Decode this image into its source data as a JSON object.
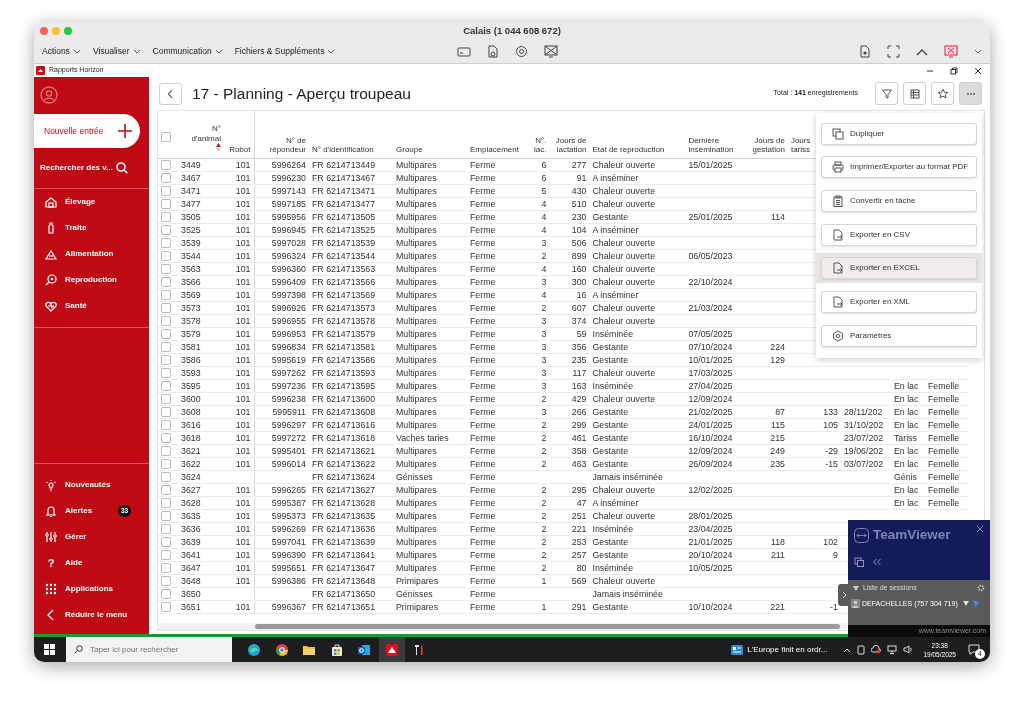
{
  "mac_window": {
    "title": "Calais (1 044 608 672)",
    "menus": [
      "Actions",
      "Visualiser",
      "Communication",
      "Fichiers & Suppléments"
    ]
  },
  "app": {
    "title": "Rapports Horizon"
  },
  "sidebar": {
    "new_entry": "Nouvelle entrée",
    "search": "Rechercher des v...",
    "nav": [
      {
        "label": "Élevage"
      },
      {
        "label": "Traite"
      },
      {
        "label": "Alimentation"
      },
      {
        "label": "Reproduction"
      },
      {
        "label": "Santé"
      }
    ],
    "footer": [
      {
        "label": "Nouveautés"
      },
      {
        "label": "Alertes",
        "badge": "33"
      },
      {
        "label": "Gérer"
      },
      {
        "label": "Aide",
        "glyph": "?"
      },
      {
        "label": "Applications"
      },
      {
        "label": "Réduire le menu"
      }
    ]
  },
  "page": {
    "title": "17 - Planning - Aperçu troupeau",
    "total": "Total : **141** enregistrements",
    "actions": [
      {
        "active": false
      },
      {
        "active": false
      },
      {
        "active": false
      },
      {
        "active": true
      }
    ]
  },
  "table": {
    "header_checked": false,
    "columns": [
      {
        "label": "N° d'animal",
        "sorted": true
      },
      {
        "label": "Robot",
        "sorted": false
      },
      {
        "label": "N° de répondeur",
        "sorted": false
      },
      {
        "label": "N° d'identification",
        "sorted": false
      },
      {
        "label": "Groupe",
        "sorted": false
      },
      {
        "label": "Emplacement",
        "sorted": false
      },
      {
        "label": "N°. lac.",
        "sorted": false
      },
      {
        "label": "Jours de lactation",
        "sorted": false
      },
      {
        "label": "Etat de reproduction",
        "sorted": false
      },
      {
        "label": "Dernière insémination",
        "sorted": false
      },
      {
        "label": "Jours de gestation",
        "sorted": false
      },
      {
        "label": "Jours tariss",
        "sorted": false
      }
    ],
    "rows": [
      {
        "checked": false,
        "animal": "3449",
        "robot": "101",
        "repondeur": "5996264",
        "identification": "FR 6214713449",
        "groupe": "Multipares",
        "emplacement": "Ferme",
        "lac": "6",
        "jours_lactation": "277",
        "etat": "Chaleur ouverte",
        "derniere_insemination": "15/01/2025"
      },
      {
        "checked": false,
        "animal": "3467",
        "robot": "101",
        "repondeur": "5996230",
        "identification": "FR 6214713467",
        "groupe": "Multipares",
        "emplacement": "Ferme",
        "lac": "6",
        "jours_lactation": "91",
        "etat": "A inséminer"
      },
      {
        "checked": false,
        "animal": "3471",
        "robot": "101",
        "repondeur": "5997143",
        "identification": "FR 6214713471",
        "groupe": "Multipares",
        "emplacement": "Ferme",
        "lac": "5",
        "jours_lactation": "430",
        "etat": "Chaleur ouverte"
      },
      {
        "checked": false,
        "animal": "3477",
        "robot": "101",
        "repondeur": "5997185",
        "identification": "FR 6214713477",
        "groupe": "Multipares",
        "emplacement": "Ferme",
        "lac": "4",
        "jours_lactation": "510",
        "etat": "Chaleur ouverte"
      },
      {
        "checked": false,
        "animal": "3505",
        "robot": "101",
        "repondeur": "5995956",
        "identification": "FR 6214713505",
        "groupe": "Multipares",
        "emplacement": "Ferme",
        "lac": "4",
        "jours_lactation": "230",
        "etat": "Gestante",
        "derniere_insemination": "25/01/2025",
        "jours_gestation": "114"
      },
      {
        "checked": false,
        "animal": "3525",
        "robot": "101",
        "repondeur": "5996945",
        "identification": "FR 6214713525",
        "groupe": "Multipares",
        "emplacement": "Ferme",
        "lac": "4",
        "jours_lactation": "104",
        "etat": "A inséminer"
      },
      {
        "checked": false,
        "animal": "3539",
        "robot": "101",
        "repondeur": "5997028",
        "identification": "FR 6214713539",
        "groupe": "Multipares",
        "emplacement": "Ferme",
        "lac": "3",
        "jours_lactation": "506",
        "etat": "Chaleur ouverte"
      },
      {
        "checked": false,
        "animal": "3544",
        "robot": "101",
        "repondeur": "5996324",
        "identification": "FR 6214713544",
        "groupe": "Multipares",
        "emplacement": "Ferme",
        "lac": "2",
        "jours_lactation": "899",
        "etat": "Chaleur ouverte",
        "derniere_insemination": "06/05/2023"
      },
      {
        "checked": false,
        "animal": "3563",
        "robot": "101",
        "repondeur": "5996360",
        "identification": "FR 6214713563",
        "groupe": "Multipares",
        "emplacement": "Ferme",
        "lac": "4",
        "jours_lactation": "160",
        "etat": "Chaleur ouverte"
      },
      {
        "checked": false,
        "animal": "3566",
        "robot": "101",
        "repondeur": "5996409",
        "identification": "FR 6214713566",
        "groupe": "Multipares",
        "emplacement": "Ferme",
        "lac": "3",
        "jours_lactation": "300",
        "etat": "Chaleur ouverte",
        "derniere_insemination": "22/10/2024"
      },
      {
        "checked": false,
        "animal": "3569",
        "robot": "101",
        "repondeur": "5997398",
        "identification": "FR 6214713569",
        "groupe": "Multipares",
        "emplacement": "Ferme",
        "lac": "4",
        "jours_lactation": "16",
        "etat": "A inséminer"
      },
      {
        "checked": false,
        "animal": "3573",
        "robot": "101",
        "repondeur": "5996926",
        "identification": "FR 6214713573",
        "groupe": "Multipares",
        "emplacement": "Ferme",
        "lac": "2",
        "jours_lactation": "607",
        "etat": "Chaleur ouverte",
        "derniere_insemination": "21/03/2024"
      },
      {
        "checked": false,
        "animal": "3578",
        "robot": "101",
        "repondeur": "5996955",
        "identification": "FR 6214713578",
        "groupe": "Multipares",
        "emplacement": "Ferme",
        "lac": "3",
        "jours_lactation": "374",
        "etat": "Chaleur ouverte"
      },
      {
        "checked": false,
        "animal": "3579",
        "robot": "101",
        "repondeur": "5996953",
        "identification": "FR 6214713579",
        "groupe": "Multipares",
        "emplacement": "Ferme",
        "lac": "3",
        "jours_lactation": "59",
        "etat": "Inséminée",
        "derniere_insemination": "07/05/2025"
      },
      {
        "checked": false,
        "animal": "3581",
        "robot": "101",
        "repondeur": "5996834",
        "identification": "FR 6214713581",
        "groupe": "Multipares",
        "emplacement": "Ferme",
        "lac": "3",
        "jours_lactation": "356",
        "etat": "Gestante",
        "derniere_insemination": "07/10/2024",
        "jours_gestation": "224"
      },
      {
        "checked": false,
        "animal": "3586",
        "robot": "101",
        "repondeur": "5995619",
        "identification": "FR 6214713586",
        "groupe": "Multipares",
        "emplacement": "Ferme",
        "lac": "3",
        "jours_lactation": "235",
        "etat": "Gestante",
        "derniere_insemination": "10/01/2025",
        "jours_gestation": "129"
      },
      {
        "checked": false,
        "animal": "3593",
        "robot": "101",
        "repondeur": "5997262",
        "identification": "FR 6214713593",
        "groupe": "Multipares",
        "emplacement": "Ferme",
        "lac": "3",
        "jours_lactation": "117",
        "etat": "Chaleur ouverte",
        "derniere_insemination": "17/03/2025"
      },
      {
        "checked": false,
        "animal": "3595",
        "robot": "101",
        "repondeur": "5997236",
        "identification": "FR 6214713595",
        "groupe": "Multipares",
        "emplacement": "Ferme",
        "lac": "3",
        "jours_lactation": "163",
        "etat": "Inséminée",
        "derniere_insemination": "27/04/2025",
        "column_14": "En lac",
        "column_15": "Femelle"
      },
      {
        "checked": false,
        "animal": "3600",
        "robot": "101",
        "repondeur": "5996238",
        "identification": "FR 6214713600",
        "groupe": "Multipares",
        "emplacement": "Ferme",
        "lac": "2",
        "jours_lactation": "429",
        "etat": "Chaleur ouverte",
        "derniere_insemination": "12/09/2024",
        "column_14": "En lac",
        "column_15": "Femelle"
      },
      {
        "checked": false,
        "animal": "3608",
        "robot": "101",
        "repondeur": "5995911",
        "identification": "FR 6214713608",
        "groupe": "Multipares",
        "emplacement": "Ferme",
        "lac": "3",
        "jours_lactation": "266",
        "etat": "Gestante",
        "derniere_insemination": "21/02/2025",
        "jours_gestation": "87",
        "jours_tariss": "133",
        "column_13": "28/11/202",
        "column_14": "En lac",
        "column_15": "Femelle"
      },
      {
        "checked": false,
        "animal": "3616",
        "robot": "101",
        "repondeur": "5996297",
        "identification": "FR 6214713616",
        "groupe": "Multipares",
        "emplacement": "Ferme",
        "lac": "2",
        "jours_lactation": "299",
        "etat": "Gestante",
        "derniere_insemination": "24/01/2025",
        "jours_gestation": "115",
        "jours_tariss": "105",
        "column_13": "31/10/202",
        "column_14": "En lac",
        "column_15": "Femelle"
      },
      {
        "checked": false,
        "animal": "3618",
        "robot": "101",
        "repondeur": "5997272",
        "identification": "FR 6214713618",
        "groupe": "Vaches taries",
        "emplacement": "Ferme",
        "lac": "2",
        "jours_lactation": "461",
        "etat": "Gestante",
        "derniere_insemination": "16/10/2024",
        "jours_gestation": "215",
        "column_13": "23/07/202",
        "column_14": "Tariss",
        "column_15": "Femelle"
      },
      {
        "checked": false,
        "animal": "3621",
        "robot": "101",
        "repondeur": "5995401",
        "identification": "FR 6214713621",
        "groupe": "Multipares",
        "emplacement": "Ferme",
        "lac": "2",
        "jours_lactation": "358",
        "etat": "Gestante",
        "derniere_insemination": "12/09/2024",
        "jours_gestation": "249",
        "jours_tariss": "-29",
        "column_13": "19/06/202",
        "column_14": "En lac",
        "column_15": "Femelle"
      },
      {
        "checked": false,
        "animal": "3622",
        "robot": "101",
        "repondeur": "5996014",
        "identification": "FR 6214713622",
        "groupe": "Multipares",
        "emplacement": "Ferme",
        "lac": "2",
        "jours_lactation": "463",
        "etat": "Gestante",
        "derniere_insemination": "26/09/2024",
        "jours_gestation": "235",
        "jours_tariss": "-15",
        "column_13": "03/07/202",
        "column_14": "En lac",
        "column_15": "Femelle"
      },
      {
        "checked": false,
        "animal": "3624",
        "identification": "FR 6214713624",
        "groupe": "Génisses",
        "emplacement": "Ferme",
        "etat": "Jamais inséminée",
        "column_14": "Génis",
        "column_15": "Femelle"
      },
      {
        "checked": false,
        "animal": "3627",
        "robot": "101",
        "repondeur": "5996265",
        "identification": "FR 6214713627",
        "groupe": "Multipares",
        "emplacement": "Ferme",
        "lac": "2",
        "jours_lactation": "295",
        "etat": "Chaleur ouverte",
        "derniere_insemination": "12/02/2025",
        "column_14": "En lac",
        "column_15": "Femelle"
      },
      {
        "checked": false,
        "animal": "3628",
        "robot": "101",
        "repondeur": "5995387",
        "identification": "FR 6214713628",
        "groupe": "Multipares",
        "emplacement": "Ferme",
        "lac": "2",
        "jours_lactation": "47",
        "etat": "A inséminer",
        "column_14": "En lac",
        "column_15": "Femelle"
      },
      {
        "checked": false,
        "animal": "3635",
        "robot": "101",
        "repondeur": "5995373",
        "identification": "FR 6214713635",
        "groupe": "Multipares",
        "emplacement": "Ferme",
        "lac": "2",
        "jours_lactation": "251",
        "etat": "Chaleur ouverte",
        "derniere_insemination": "28/01/2025"
      },
      {
        "checked": false,
        "animal": "3636",
        "robot": "101",
        "repondeur": "5996269",
        "identification": "FR 6214713636",
        "groupe": "Multipares",
        "emplacement": "Ferme",
        "lac": "2",
        "jours_lactation": "221",
        "etat": "Inséminée",
        "derniere_insemination": "23/04/2025"
      },
      {
        "checked": false,
        "animal": "3639",
        "robot": "101",
        "repondeur": "5997041",
        "identification": "FR 6214713639",
        "groupe": "Multipares",
        "emplacement": "Ferme",
        "lac": "2",
        "jours_lactation": "253",
        "etat": "Gestante",
        "derniere_insemination": "21/01/2025",
        "jours_gestation": "118",
        "jours_tariss": "102"
      },
      {
        "checked": false,
        "animal": "3641",
        "robot": "101",
        "repondeur": "5996390",
        "identification": "FR 6214713641",
        "groupe": "Multipares",
        "emplacement": "Ferme",
        "lac": "2",
        "jours_lactation": "257",
        "etat": "Gestante",
        "derniere_insemination": "20/10/2024",
        "jours_gestation": "211",
        "jours_tariss": "9"
      },
      {
        "checked": false,
        "animal": "3647",
        "robot": "101",
        "repondeur": "5995651",
        "identification": "FR 6214713647",
        "groupe": "Multipares",
        "emplacement": "Ferme",
        "lac": "2",
        "jours_lactation": "80",
        "etat": "Inséminée",
        "derniere_insemination": "10/05/2025"
      },
      {
        "checked": false,
        "animal": "3648",
        "robot": "101",
        "repondeur": "5996386",
        "identification": "FR 6214713648",
        "groupe": "Primipares",
        "emplacement": "Ferme",
        "lac": "1",
        "jours_lactation": "569",
        "etat": "Chaleur ouverte"
      },
      {
        "checked": false,
        "animal": "3650",
        "identification": "FR 6214713650",
        "groupe": "Génisses",
        "emplacement": "Ferme",
        "etat": "Jamais inséminée"
      },
      {
        "checked": false,
        "animal": "3651",
        "robot": "101",
        "repondeur": "5996367",
        "identification": "FR 6214713651",
        "groupe": "Primipares",
        "emplacement": "Ferme",
        "lac": "1",
        "jours_lactation": "291",
        "etat": "Gestante",
        "derniere_insemination": "10/10/2024",
        "jours_gestation": "221",
        "jours_tariss": "-1"
      }
    ]
  },
  "more_menu": {
    "items": [
      {
        "label": "Dupliquer",
        "highlighted": false
      },
      {
        "label": "Imprimer/Exporter au format PDF",
        "highlighted": false
      },
      {
        "label": "Convertir en tâche",
        "highlighted": false
      },
      {
        "label": "Exporter en CSV",
        "highlighted": false
      },
      {
        "label": "Exporter en EXCEL",
        "highlighted": true
      },
      {
        "label": "Exporter en XML",
        "highlighted": false
      },
      {
        "label": "Paramètres",
        "highlighted": false
      }
    ]
  },
  "teamviewer": {
    "logo": "TeamViewer",
    "section": "Liste de sessions",
    "session": "DEFACHELLES (757 304 719)",
    "url": "www.teamviewer.com"
  },
  "taskbar": {
    "search_placeholder": "Taper ici pour rechercher",
    "apps": [
      {
        "active": false
      },
      {
        "active": false
      },
      {
        "active": false
      },
      {
        "active": false
      },
      {
        "active": false
      },
      {
        "active": true
      },
      {
        "active": false
      }
    ],
    "news": "L'Europe finit en ordr...",
    "time": "23:38",
    "date": "19/05/2025",
    "notifications": "4"
  }
}
